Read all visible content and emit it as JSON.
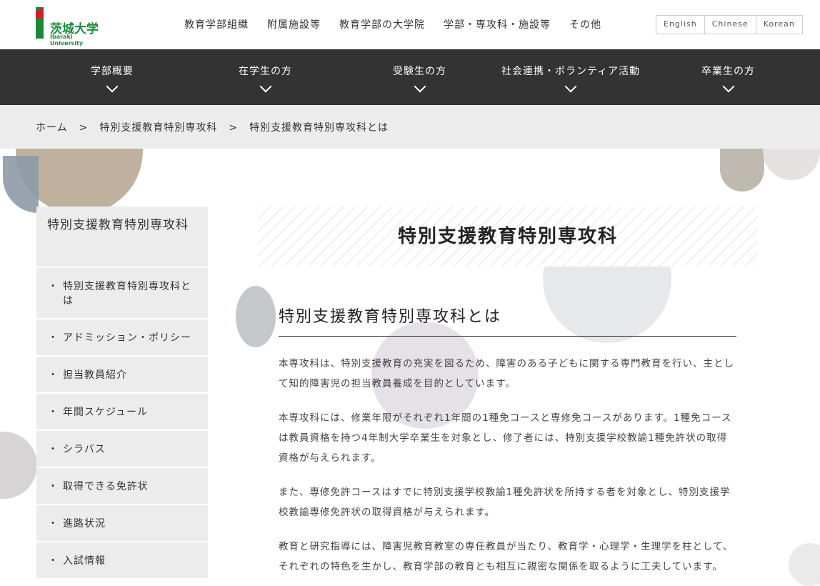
{
  "header": {
    "logo_jp": "茨城大学",
    "logo_en": "Ibaraki University",
    "topnav": [
      "教育学部組織",
      "附属施設等",
      "教育学部の大学院",
      "学部・専攻科・施設等",
      "その他"
    ],
    "languages": [
      "English",
      "Chinese",
      "Korean"
    ]
  },
  "mainnav": [
    "学部概要",
    "在学生の方",
    "受験生の方",
    "社会連携・ボランティア活動",
    "卒業生の方"
  ],
  "breadcrumb": {
    "items": [
      "ホーム",
      "特別支援教育特別専攻科",
      "特別支援教育特別専攻科とは"
    ],
    "separator": ">"
  },
  "sidebar": {
    "title": "特別支援教育特別専攻科",
    "items": [
      "特別支援教育特別専攻科とは",
      "アドミッション・ポリシー",
      "担当教員紹介",
      "年間スケジュール",
      "シラバス",
      "取得できる免許状",
      "進路状況",
      "入試情報"
    ]
  },
  "main": {
    "page_title": "特別支援教育特別専攻科",
    "section_title": "特別支援教育特別専攻科とは",
    "paragraphs": [
      "本専攻科は、特別支援教育の充実を図るため、障害のある子どもに関する専門教育を行い、主として知的障害児の担当教員養成を目的としています。",
      "本専攻科には、修業年限がそれぞれ1年間の1種免コースと専修免コースがあります。1種免コースは教員資格を持つ4年制大学卒業生を対象とし、修了者には、特別支援学校教諭1種免許状の取得資格が与えられます。",
      "また、専修免許コースはすでに特別支援学校教諭1種免許状を所持する者を対象とし、特別支援学校教諭専修免許状の取得資格が与えられます。",
      "教育と研究指導には、障害児教育教室の専任教員が当たり、教育学・心理学・生理学を柱として、それぞれの特色を生かし、教育学部の教育とも相互に親密な関係を取るように工夫しています。"
    ]
  }
}
